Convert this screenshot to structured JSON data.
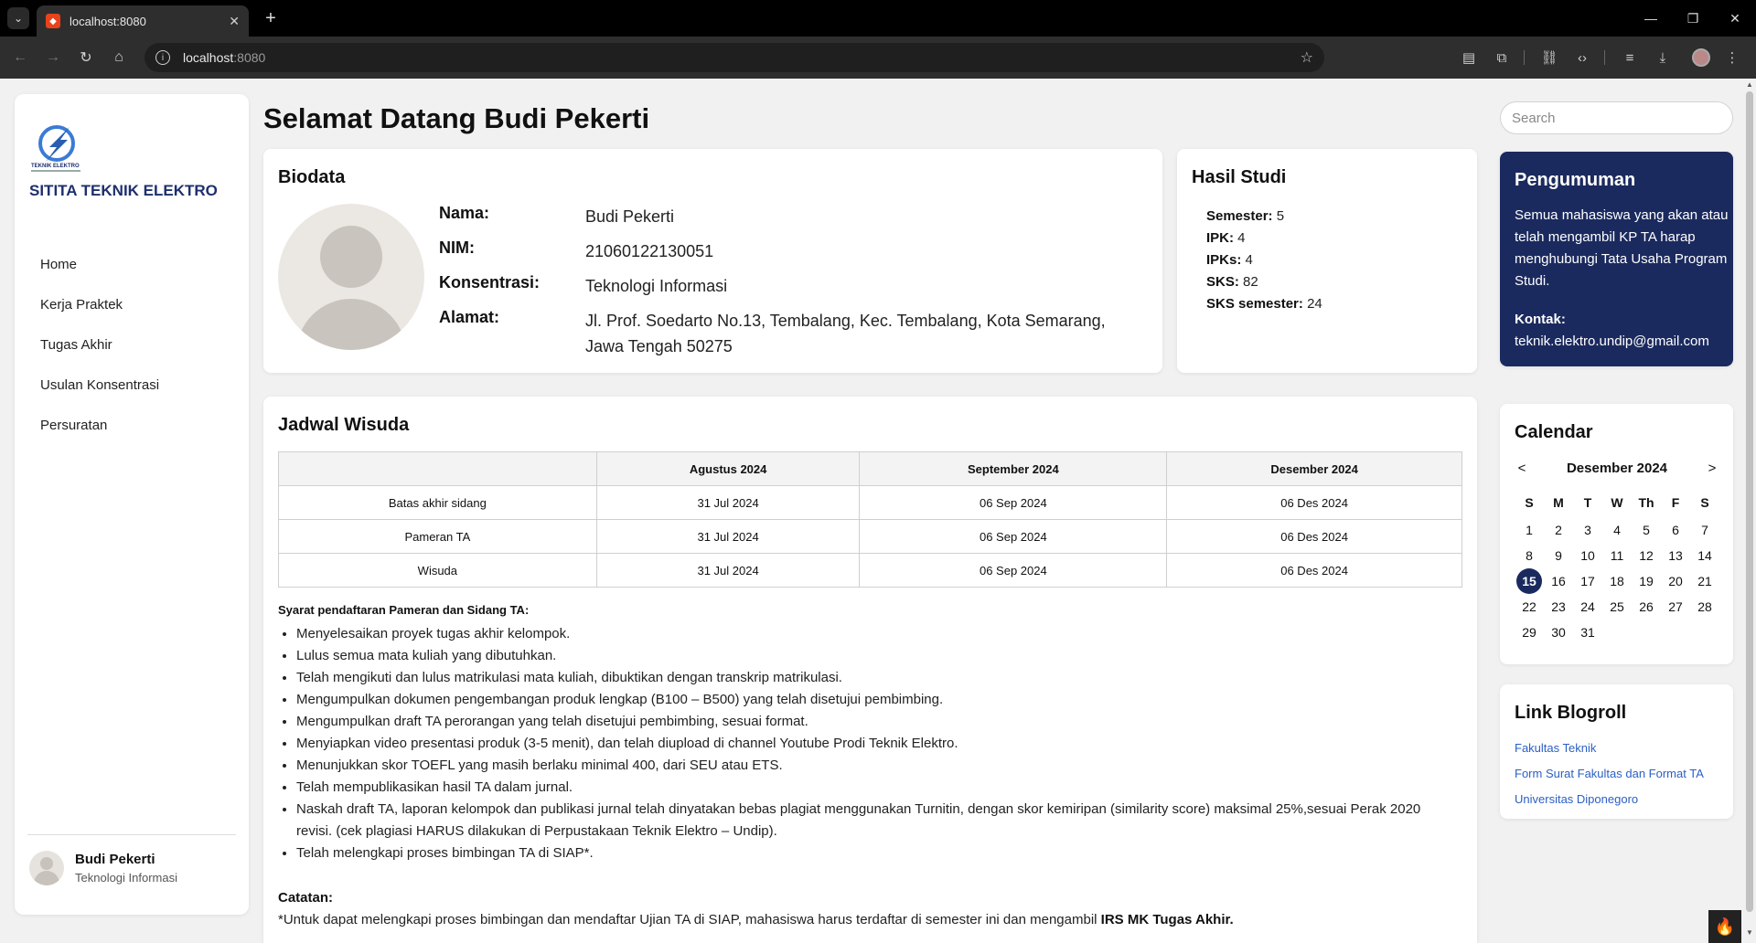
{
  "browser": {
    "tab_title": "localhost:8080",
    "url_host": "localhost",
    "url_port": ":8080"
  },
  "sidebar": {
    "logo_caption": "TEKNIK ELEKTRO",
    "app_title": "SITITA TEKNIK ELEKTRO",
    "menu": [
      "Home",
      "Kerja Praktek",
      "Tugas Akhir",
      "Usulan Konsentrasi",
      "Persuratan"
    ],
    "user_name": "Budi Pekerti",
    "user_role": "Teknologi Informasi"
  },
  "header": {
    "welcome": "Selamat Datang Budi Pekerti"
  },
  "biodata": {
    "title": "Biodata",
    "rows": [
      {
        "label": "Nama:",
        "value": "Budi Pekerti"
      },
      {
        "label": "NIM:",
        "value": "21060122130051"
      },
      {
        "label": "Konsentrasi:",
        "value": "Teknologi Informasi"
      },
      {
        "label": "Alamat:",
        "value": "Jl. Prof. Soedarto No.13, Tembalang, Kec. Tembalang, Kota Semarang, Jawa Tengah 50275"
      }
    ]
  },
  "hasil_studi": {
    "title": "Hasil Studi",
    "items": [
      {
        "label": "Semester:",
        "value": "5"
      },
      {
        "label": "IPK:",
        "value": "4"
      },
      {
        "label": "IPKs:",
        "value": "4"
      },
      {
        "label": "SKS:",
        "value": "82"
      },
      {
        "label": "SKS semester:",
        "value": "24"
      }
    ]
  },
  "jadwal": {
    "title": "Jadwal Wisuda",
    "columns": [
      "",
      "Agustus 2024",
      "September 2024",
      "Desember 2024"
    ],
    "rows": [
      [
        "Batas akhir sidang",
        "31 Jul 2024",
        "06 Sep 2024",
        "06 Des 2024"
      ],
      [
        "Pameran TA",
        "31 Jul 2024",
        "06 Sep 2024",
        "06 Des 2024"
      ],
      [
        "Wisuda",
        "31 Jul 2024",
        "06 Sep 2024",
        "06 Des 2024"
      ]
    ],
    "syarat_title": "Syarat pendaftaran Pameran dan Sidang TA:",
    "syarat": [
      "Menyelesaikan proyek tugas akhir kelompok.",
      "Lulus semua mata kuliah yang dibutuhkan.",
      "Telah mengikuti dan lulus matrikulasi mata kuliah, dibuktikan dengan transkrip matrikulasi.",
      "Mengumpulkan dokumen pengembangan produk lengkap (B100 – B500) yang telah disetujui pembimbing.",
      "Mengumpulkan draft TA perorangan yang telah disetujui pembimbing, sesuai format.",
      "Menyiapkan video presentasi produk (3-5 menit), dan telah diupload di channel Youtube Prodi Teknik Elektro.",
      "Menunjukkan skor TOEFL yang masih berlaku minimal 400, dari SEU atau ETS.",
      "Telah mempublikasikan hasil TA dalam jurnal.",
      "Naskah draft TA, laporan kelompok dan publikasi jurnal telah dinyatakan bebas plagiat menggunakan Turnitin, dengan skor kemiripan (similarity score) maksimal 25%,sesuai Perak 2020 revisi. (cek plagiasi HARUS dilakukan di Perpustakaan Teknik Elektro – Undip).",
      "Telah melengkapi proses bimbingan TA di SIAP*."
    ],
    "catatan_title": "Catatan:",
    "catatan_text": "*Untuk dapat melengkapi proses bimbingan dan mendaftar Ujian TA di SIAP, mahasiswa harus terdaftar di semester ini dan mengambil ",
    "catatan_bold": "IRS MK Tugas Akhir."
  },
  "search": {
    "placeholder": "Search"
  },
  "pengumuman": {
    "title": "Pengumuman",
    "body": "Semua mahasiswa yang akan atau telah mengambil KP TA harap menghubungi Tata Usaha Program Studi.",
    "kontak_label": "Kontak:",
    "kontak_email": "teknik.elektro.undip@gmail.com"
  },
  "calendar": {
    "title": "Calendar",
    "month": "Desember 2024",
    "prev": "<",
    "next": ">",
    "weekdays": [
      "S",
      "M",
      "T",
      "W",
      "Th",
      "F",
      "S"
    ],
    "days": 31,
    "start_offset": 0,
    "today": 15
  },
  "blogroll": {
    "title": "Link Blogroll",
    "links": [
      "Fakultas Teknik",
      "Form Surat Fakultas dan Format TA",
      "Universitas Diponegoro"
    ]
  },
  "colors": {
    "brand_navy": "#1b2a5e",
    "link_blue": "#2b5fc4"
  }
}
